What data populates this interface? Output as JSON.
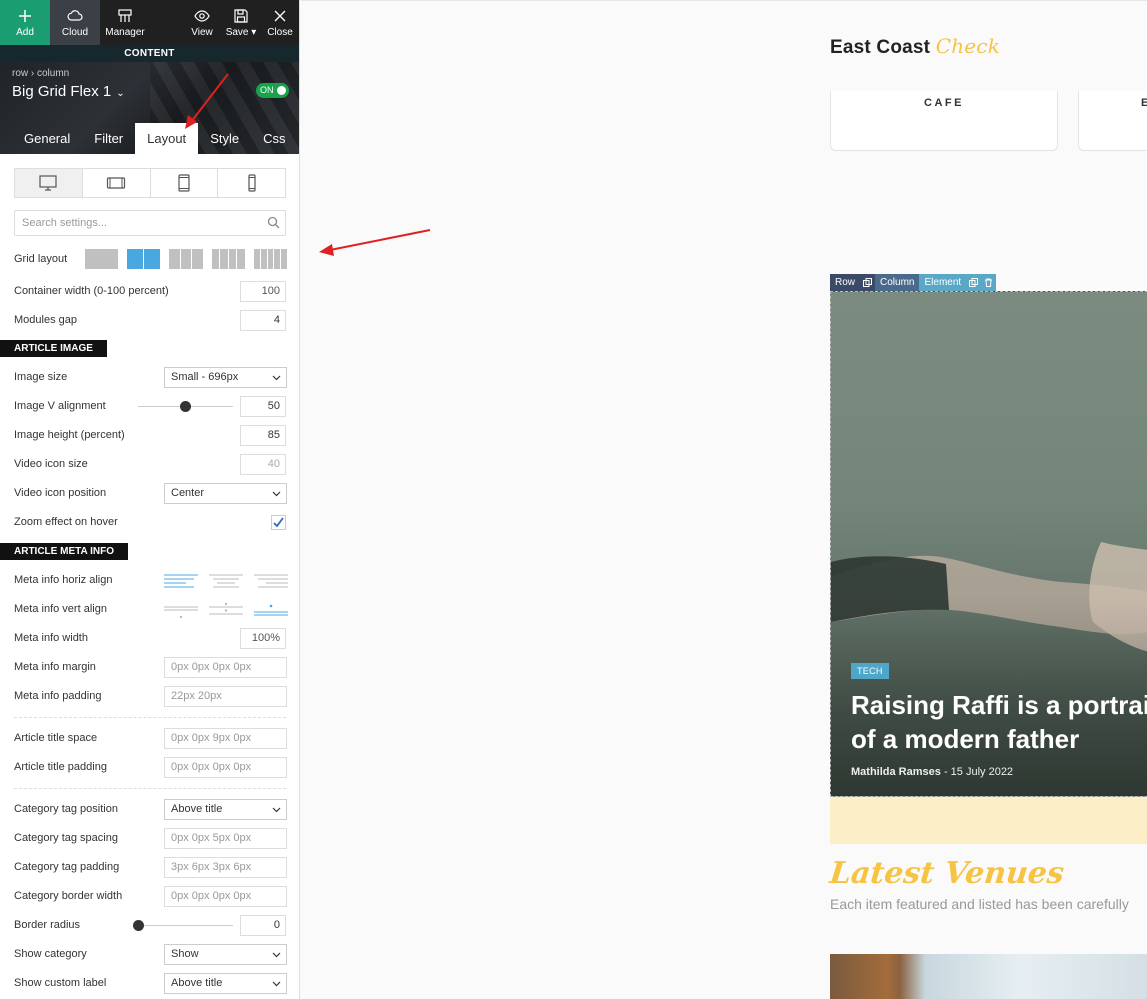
{
  "toolbar": {
    "add": "Add",
    "cloud": "Cloud",
    "manager": "Manager",
    "view": "View",
    "save": "Save",
    "close": "Close",
    "content": "CONTENT"
  },
  "header": {
    "breadcrumb": "row  ›  column",
    "module_title": "Big Grid Flex 1",
    "toggle": "ON"
  },
  "tabs": [
    "General",
    "Filter",
    "Layout",
    "Style",
    "Css"
  ],
  "search": {
    "placeholder": "Search settings..."
  },
  "settings": {
    "grid_layout": "Grid layout",
    "container_width": {
      "label": "Container width (0-100 percent)",
      "value": "100"
    },
    "modules_gap": {
      "label": "Modules gap",
      "value": "4"
    },
    "section_image": "ARTICLE IMAGE",
    "image_size": {
      "label": "Image size",
      "value": "Small - 696px"
    },
    "image_v_align": {
      "label": "Image V alignment",
      "value": "50",
      "fraction": 0.5
    },
    "image_height": {
      "label": "Image height (percent)",
      "value": "85"
    },
    "video_icon_size": {
      "label": "Video icon size",
      "value": "40"
    },
    "video_icon_position": {
      "label": "Video icon position",
      "value": "Center"
    },
    "zoom_effect": {
      "label": "Zoom effect on hover",
      "checked": true
    },
    "section_meta": "ARTICLE META INFO",
    "meta_horiz": "Meta info horiz align",
    "meta_vert": "Meta info vert align",
    "meta_width": {
      "label": "Meta info width",
      "value": "100%"
    },
    "meta_margin": {
      "label": "Meta info margin",
      "placeholder": "0px 0px 0px 0px"
    },
    "meta_padding": {
      "label": "Meta info padding",
      "placeholder": "22px 20px"
    },
    "title_space": {
      "label": "Article title space",
      "placeholder": "0px 0px 9px 0px"
    },
    "title_padding": {
      "label": "Article title padding",
      "placeholder": "0px 0px 0px 0px"
    },
    "cat_position": {
      "label": "Category tag position",
      "value": "Above title"
    },
    "cat_spacing": {
      "label": "Category tag spacing",
      "placeholder": "0px 0px 5px 0px"
    },
    "cat_padding": {
      "label": "Category tag padding",
      "placeholder": "3px 6px 3px 6px"
    },
    "cat_border": {
      "label": "Category border width",
      "placeholder": "0px 0px 0px 0px"
    },
    "border_radius": {
      "label": "Border radius",
      "value": "0",
      "fraction": 0
    },
    "show_category": {
      "label": "Show category",
      "value": "Show"
    },
    "show_custom_label": {
      "label": "Show custom label",
      "value": "Above title"
    }
  },
  "preview": {
    "brand": "East Coast",
    "brand_script": "Check",
    "categories": [
      "CAFE",
      "EN"
    ],
    "editbar": {
      "row": "Row",
      "column": "Column",
      "element": "Element"
    },
    "feature": {
      "tag": "TECH",
      "title": "Raising Raffi is a portrait of a modern father",
      "author": "Mathilda Ramses",
      "date": "15 July 2022"
    },
    "latest_title": "Latest Venues",
    "latest_sub": "Each item featured and listed has been carefully"
  },
  "colors": {
    "accent_green": "#1b9d72",
    "accent_blue": "#4aa8e0",
    "brand_yellow": "#f6c343",
    "tag_blue": "#4ea6c8",
    "arrow_red": "#e02020"
  }
}
